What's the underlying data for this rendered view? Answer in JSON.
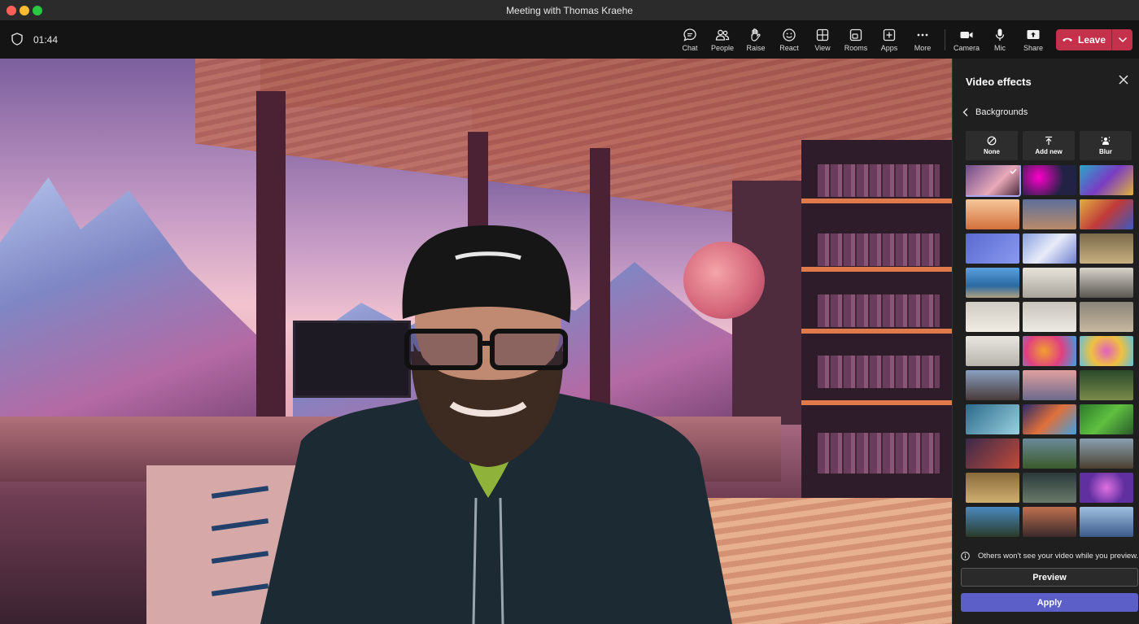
{
  "window": {
    "title": "Meeting with Thomas Kraehe"
  },
  "toolbar": {
    "timer": "01:44",
    "buttons": [
      {
        "label": "Chat",
        "icon": "chat-icon"
      },
      {
        "label": "People",
        "icon": "people-icon"
      },
      {
        "label": "Raise",
        "icon": "raise-hand-icon"
      },
      {
        "label": "React",
        "icon": "smiley-icon"
      },
      {
        "label": "View",
        "icon": "grid-view-icon"
      },
      {
        "label": "Rooms",
        "icon": "rooms-icon"
      },
      {
        "label": "Apps",
        "icon": "apps-plus-icon"
      },
      {
        "label": "More",
        "icon": "ellipsis-icon"
      },
      {
        "label": "Camera",
        "icon": "camera-icon"
      },
      {
        "label": "Mic",
        "icon": "mic-icon"
      },
      {
        "label": "Share",
        "icon": "share-icon"
      }
    ],
    "leave_label": "Leave"
  },
  "panel": {
    "title": "Video effects",
    "section": "Backgrounds",
    "options": [
      {
        "label": "None",
        "icon": "none-icon"
      },
      {
        "label": "Add new",
        "icon": "upload-icon"
      },
      {
        "label": "Blur",
        "icon": "blur-icon"
      }
    ],
    "info_text": "Others won't see your video while you preview.",
    "preview_label": "Preview",
    "apply_label": "Apply",
    "selected_index": 0
  },
  "colors": {
    "accent": "#5b5fc7",
    "leave": "#c4314b",
    "panel_bg": "#1f1f1f",
    "toolbar_bg": "#141414"
  }
}
